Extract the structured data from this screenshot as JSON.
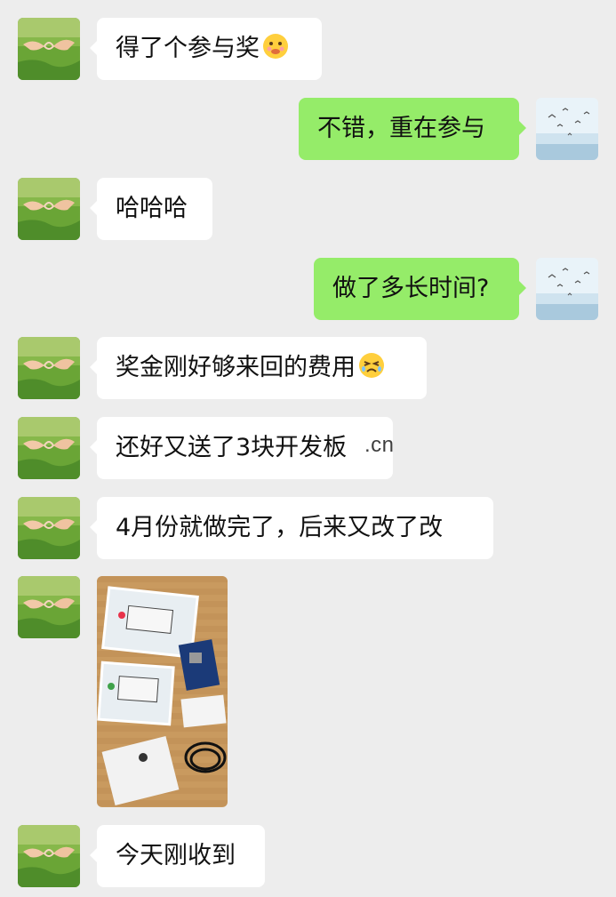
{
  "messages": [
    {
      "side": "in",
      "text": "得了个参与奖",
      "emoji": "drooling-face-emoji"
    },
    {
      "side": "out",
      "text": "不错，重在参与"
    },
    {
      "side": "in",
      "text": "哈哈哈"
    },
    {
      "side": "out",
      "text": "做了多长时间?"
    },
    {
      "side": "in",
      "text": "奖金刚好够来回的费用",
      "emoji": "tired-face-emoji"
    },
    {
      "side": "in",
      "text": "还好又送了3块开发板"
    },
    {
      "side": "in",
      "text": "4月份就做完了，后来又改了改"
    },
    {
      "side": "in",
      "type": "image",
      "image": "photo-of-dev-boards"
    },
    {
      "side": "in",
      "text": "今天刚收到"
    }
  ],
  "watermark": ".cn",
  "colors": {
    "background": "#ededed",
    "incoming_bubble": "#ffffff",
    "outgoing_bubble": "#95ec69"
  }
}
